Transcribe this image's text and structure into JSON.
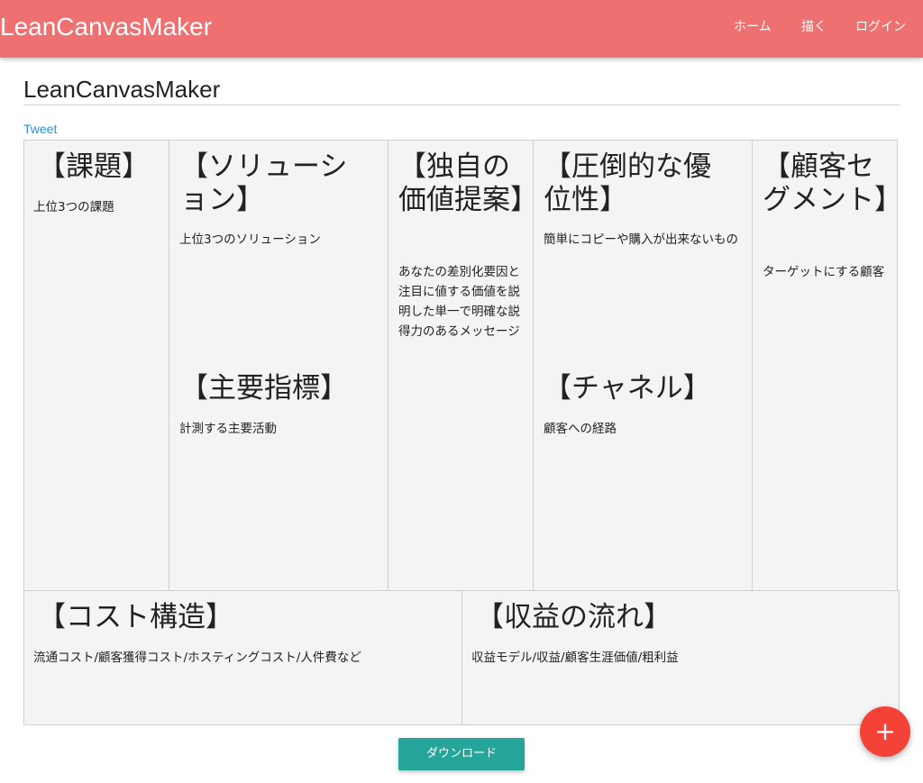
{
  "navbar": {
    "brand": "LeanCanvasMaker",
    "items": [
      {
        "label": "ホーム"
      },
      {
        "label": "描く"
      },
      {
        "label": "ログイン"
      }
    ]
  },
  "page": {
    "title": "LeanCanvasMaker",
    "tweet_label": "Tweet"
  },
  "canvas": {
    "problem": {
      "heading": "【課題】",
      "body": "上位3つの課題"
    },
    "solution": {
      "heading": "【ソリューション】",
      "body": "上位3つのソリューション"
    },
    "key_metrics": {
      "heading": "【主要指標】",
      "body": "計測する主要活動"
    },
    "unique_value": {
      "heading": "【独自の価値提案】",
      "body": "あなたの差別化要因と注目に値する価値を説明した単一で明確な説得力のあるメッセージ"
    },
    "unfair_advantage": {
      "heading": "【圧倒的な優位性】",
      "body": "簡単にコピーや購入が出来ないもの"
    },
    "channels": {
      "heading": "【チャネル】",
      "body": "顧客への経路"
    },
    "customer_segments": {
      "heading": "【顧客セグメント】",
      "body": "ターゲットにする顧客"
    },
    "cost_structure": {
      "heading": "【コスト構造】",
      "body": "流通コスト/顧客獲得コスト/ホスティングコスト/人件費など"
    },
    "revenue_streams": {
      "heading": "【収益の流れ】",
      "body": "収益モデル/収益/顧客生涯価値/粗利益"
    }
  },
  "actions": {
    "download_label": "ダウンロード",
    "fab_symbol": "+"
  },
  "colors": {
    "navbar": "#ef7070",
    "download": "#26a69a",
    "fab": "#f44336",
    "tweet_link": "#1b95e0",
    "cell_background": "#f4f4f4"
  }
}
